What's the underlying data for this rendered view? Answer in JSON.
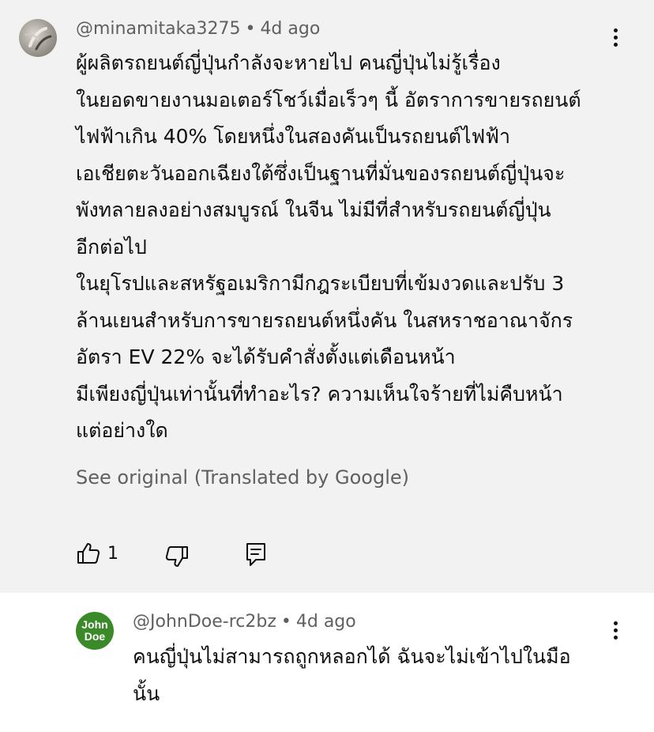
{
  "main_comment": {
    "author": "@minamitaka3275",
    "separator": "•",
    "time": "4d ago",
    "lines": [
      "ผู้ผลิตรถยนต์ญี่ปุ่นกำลังจะหายไป คนญี่ปุ่นไม่รู้เรื่อง",
      "ในยอดขายงานมอเตอร์โชว์เมื่อเร็วๆ นี้ อัตราการขายรถยนต์",
      "ไฟฟ้าเกิน 40% โดยหนึ่งในสองคันเป็นรถยนต์ไฟฟ้า",
      "เอเชียตะวันออกเฉียงใต้ซึ่งเป็นฐานที่มั่นของรถยนต์ญี่ปุ่นจะ",
      "พังทลายลงอย่างสมบูรณ์ ในจีน ไม่มีที่สำหรับรถยนต์ญี่ปุ่น",
      "อีกต่อไป",
      "ในยุโรปและสหรัฐอเมริกามีกฎระเบียบที่เข้มงวดและปรับ 3",
      "ล้านเยนสำหรับการขายรถยนต์หนึ่งคัน ในสหราชอาณาจักร",
      "อัตรา EV 22% จะได้รับคำสั่งตั้งแต่เดือนหน้า",
      "มีเพียงญี่ปุ่นเท่านั้นที่ทำอะไร? ความเห็นใจร้ายที่ไม่คืบหน้า",
      "แต่อย่างใด"
    ],
    "see_original": "See original (Translated by Google)",
    "like_count": "1"
  },
  "reply": {
    "avatar_text_1": "John",
    "avatar_text_2": "Doe",
    "author": "@JohnDoe-rc2bz",
    "separator": "•",
    "time": "4d ago",
    "lines": [
      "คนญี่ปุ่นไม่สามารถถูกหลอกได้ ฉันจะไม่เข้าไปในมือ",
      "นั้น"
    ]
  },
  "colors": {
    "comment_bg": "#f2f2f2",
    "reply_avatar_bg": "#3a8a2a",
    "secondary_text": "#606060"
  },
  "icons": [
    "kebab-menu-icon",
    "thumbs-up-icon",
    "thumbs-down-icon",
    "reply-icon"
  ]
}
